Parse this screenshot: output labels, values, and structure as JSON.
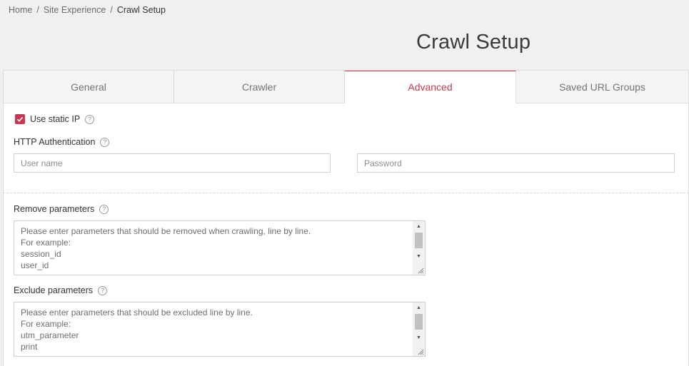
{
  "breadcrumb": {
    "items": [
      "Home",
      "Site Experience",
      "Crawl Setup"
    ],
    "separator": "/"
  },
  "page": {
    "title": "Crawl Setup"
  },
  "tabs": [
    {
      "label": "General"
    },
    {
      "label": "Crawler"
    },
    {
      "label": "Advanced"
    },
    {
      "label": "Saved URL Groups"
    }
  ],
  "active_tab": "Advanced",
  "static_ip": {
    "label": "Use static IP",
    "checked": true
  },
  "http_auth": {
    "label": "HTTP Authentication",
    "username_placeholder": "User name",
    "password_placeholder": "Password"
  },
  "remove_params": {
    "label": "Remove parameters",
    "placeholder": "Please enter parameters that should be removed when crawling, line by line.\nFor example:\nsession_id\nuser_id"
  },
  "exclude_params": {
    "label": "Exclude parameters",
    "placeholder": "Please enter parameters that should be excluded line by line.\nFor example:\nutm_parameter\nprint"
  },
  "help_glyph": "?",
  "colors": {
    "accent": "#c8374f",
    "background": "#f0f0f1",
    "panel": "#ffffff"
  },
  "icons": [
    "checkmark-icon",
    "help-icon",
    "scroll-up-icon",
    "scroll-down-icon",
    "resize-grip-icon"
  ]
}
